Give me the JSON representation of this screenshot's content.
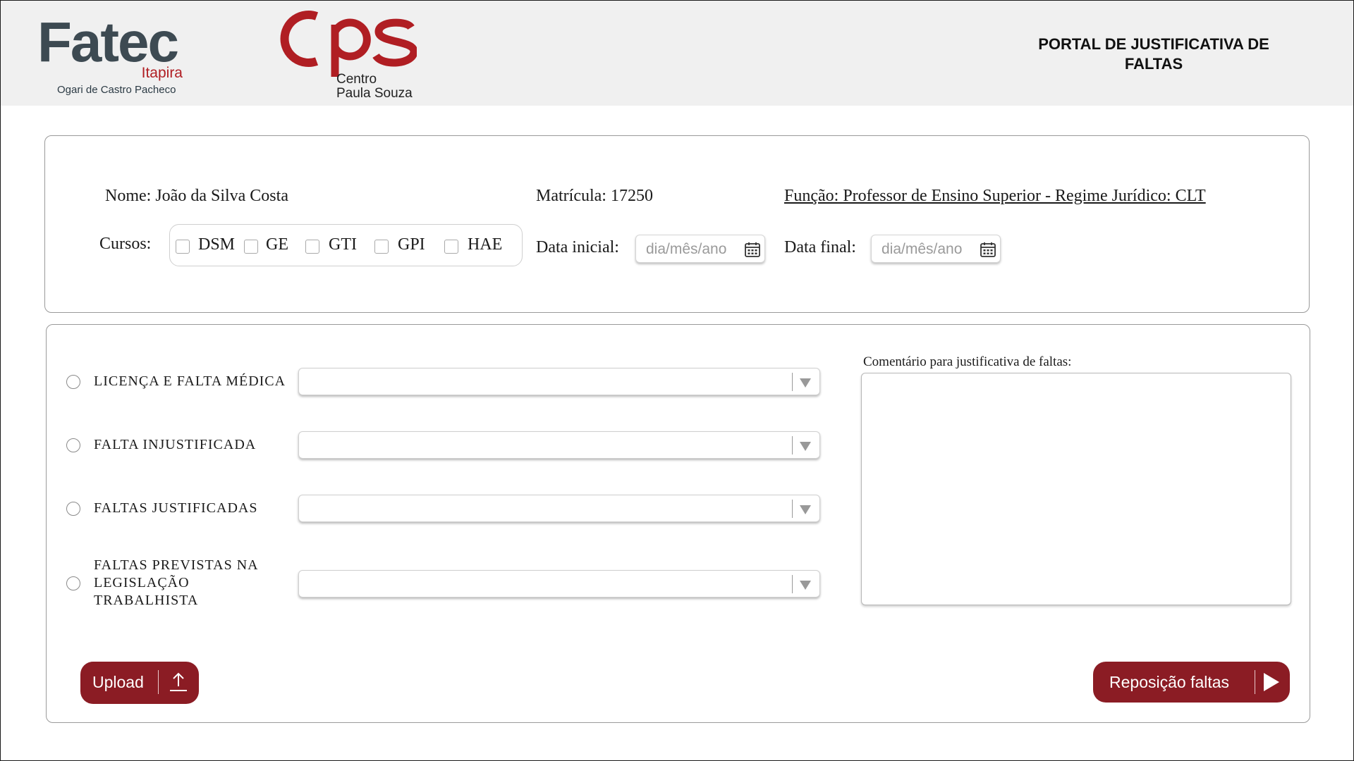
{
  "header": {
    "fatec_logo": {
      "name": "Fatec",
      "city": "Itapira",
      "subtitle": "Ogari de Castro Pacheco"
    },
    "cps_logo": {
      "line1": "Centro",
      "line2": "Paula Souza"
    },
    "portal_title": "PORTAL DE JUSTIFICATIVA DE FALTAS"
  },
  "info": {
    "nome": "Nome: João da Silva Costa",
    "matricula": "Matrícula: 17250",
    "funcao": "Função: Professor de Ensino Superior - Regime Jurídico: CLT",
    "cursos_label": "Cursos:",
    "cursos": [
      {
        "label": "DSM",
        "checked": false
      },
      {
        "label": "GE",
        "checked": false
      },
      {
        "label": "GTI",
        "checked": false
      },
      {
        "label": "GPI",
        "checked": false
      },
      {
        "label": "HAE",
        "checked": false
      }
    ],
    "data_inicial_label": "Data inicial:",
    "data_final_label": "Data final:",
    "date_placeholder": "dia/mês/ano"
  },
  "form": {
    "options": [
      {
        "label": "LICENÇA E FALTA MÉDICA",
        "selected": false,
        "select_value": ""
      },
      {
        "label": "FALTA INJUSTIFICADA",
        "selected": false,
        "select_value": ""
      },
      {
        "label": "FALTAS JUSTIFICADAS",
        "selected": false,
        "select_value": ""
      },
      {
        "label": "FALTAS PREVISTAS NA LEGISLAÇÃO TRABALHISTA",
        "selected": false,
        "select_value": ""
      }
    ],
    "comment_label": "Comentário para justificativa de faltas:",
    "comment_value": "",
    "upload_label": "Upload",
    "reposicao_label": "Reposição faltas"
  },
  "colors": {
    "brand_red": "#8b1c24",
    "logo_red": "#b01e23",
    "logo_gray": "#3d4a52",
    "header_bg": "#f0f0f0"
  },
  "icons": [
    "calendar-icon",
    "upload-arrow-icon",
    "play-arrow-icon",
    "dropdown-arrow-icon"
  ]
}
